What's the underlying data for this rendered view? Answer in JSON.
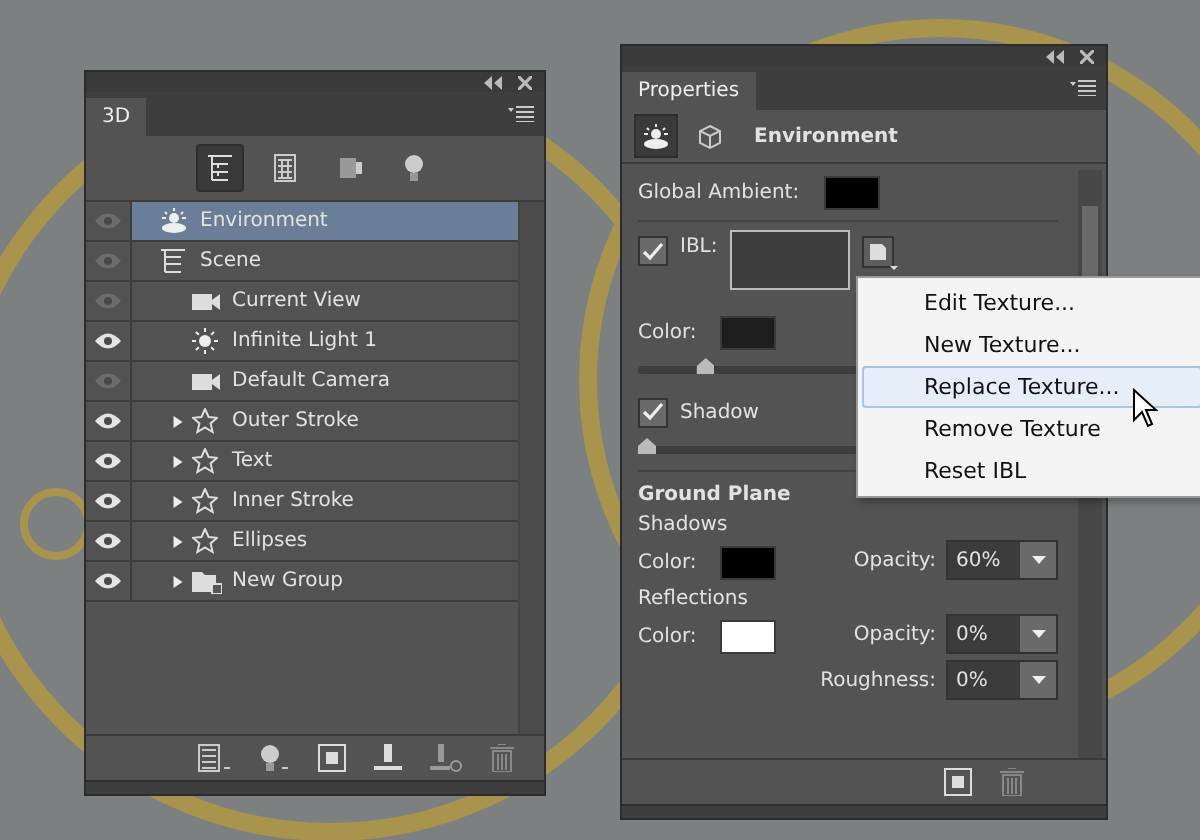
{
  "layers_panel": {
    "tab": {
      "label": "3D",
      "selected": true
    },
    "filters": [
      {
        "kind": "scene",
        "selected": true
      },
      {
        "kind": "materials",
        "selected": false
      },
      {
        "kind": "mesh",
        "selected": false
      },
      {
        "kind": "light",
        "selected": false
      }
    ],
    "layers": [
      {
        "name": "Environment",
        "kind": "environment",
        "visible": false,
        "selected": true
      },
      {
        "name": "Scene",
        "kind": "scene",
        "visible": false,
        "selected": false,
        "children": [
          {
            "name": "Current View",
            "kind": "camera",
            "visible": false,
            "selected": false
          },
          {
            "name": "Infinite Light 1",
            "kind": "light",
            "visible": true,
            "selected": false
          },
          {
            "name": "Default Camera",
            "kind": "camera",
            "visible": false,
            "selected": false
          },
          {
            "name": "Outer Stroke",
            "kind": "mesh",
            "visible": true,
            "selected": false,
            "expanded": false
          },
          {
            "name": "Text",
            "kind": "mesh",
            "visible": true,
            "selected": false,
            "expanded": false
          },
          {
            "name": "Inner Stroke",
            "kind": "mesh",
            "visible": true,
            "selected": false,
            "expanded": false
          },
          {
            "name": "Ellipses",
            "kind": "mesh",
            "visible": true,
            "selected": false,
            "expanded": false
          },
          {
            "name": "New Group",
            "kind": "group",
            "visible": true,
            "selected": false,
            "expanded": false
          }
        ]
      }
    ]
  },
  "properties_panel": {
    "tab": {
      "label": "Properties",
      "selected": true
    },
    "mode_icons": [
      {
        "kind": "environment",
        "selected": true
      },
      {
        "kind": "mesh",
        "selected": false
      }
    ],
    "title": "Environment",
    "global_ambient": {
      "label": "Global Ambient:",
      "color": "#000000"
    },
    "ibl": {
      "label": "IBL:",
      "checked": true
    },
    "ibl_color": {
      "label": "Color:",
      "color": "#1e1e1e"
    },
    "ibl_slider": {
      "level": 0.14
    },
    "shadow": {
      "label": "Shadow",
      "checked": true
    },
    "shadow_slider": {
      "level": 0
    },
    "ground_plane": {
      "title": "Ground Plane",
      "sections": [
        {
          "title": "Shadows",
          "color_label": "Color:",
          "color": "#000000",
          "fields": [
            {
              "label": "Opacity:",
              "value": "60%"
            }
          ]
        },
        {
          "title": "Reflections",
          "color_label": "Color:",
          "color": "#ffffff",
          "fields": [
            {
              "label": "Opacity:",
              "value": "0%"
            },
            {
              "label": "Roughness:",
              "value": "0%"
            }
          ]
        }
      ]
    }
  },
  "context_menu": {
    "items": [
      {
        "label": "Edit Texture...",
        "selected": false
      },
      {
        "label": "New Texture...",
        "selected": false
      },
      {
        "label": "Replace Texture...",
        "selected": true
      },
      {
        "label": "Remove Texture",
        "selected": false
      },
      {
        "label": "Reset IBL",
        "selected": false
      }
    ]
  }
}
